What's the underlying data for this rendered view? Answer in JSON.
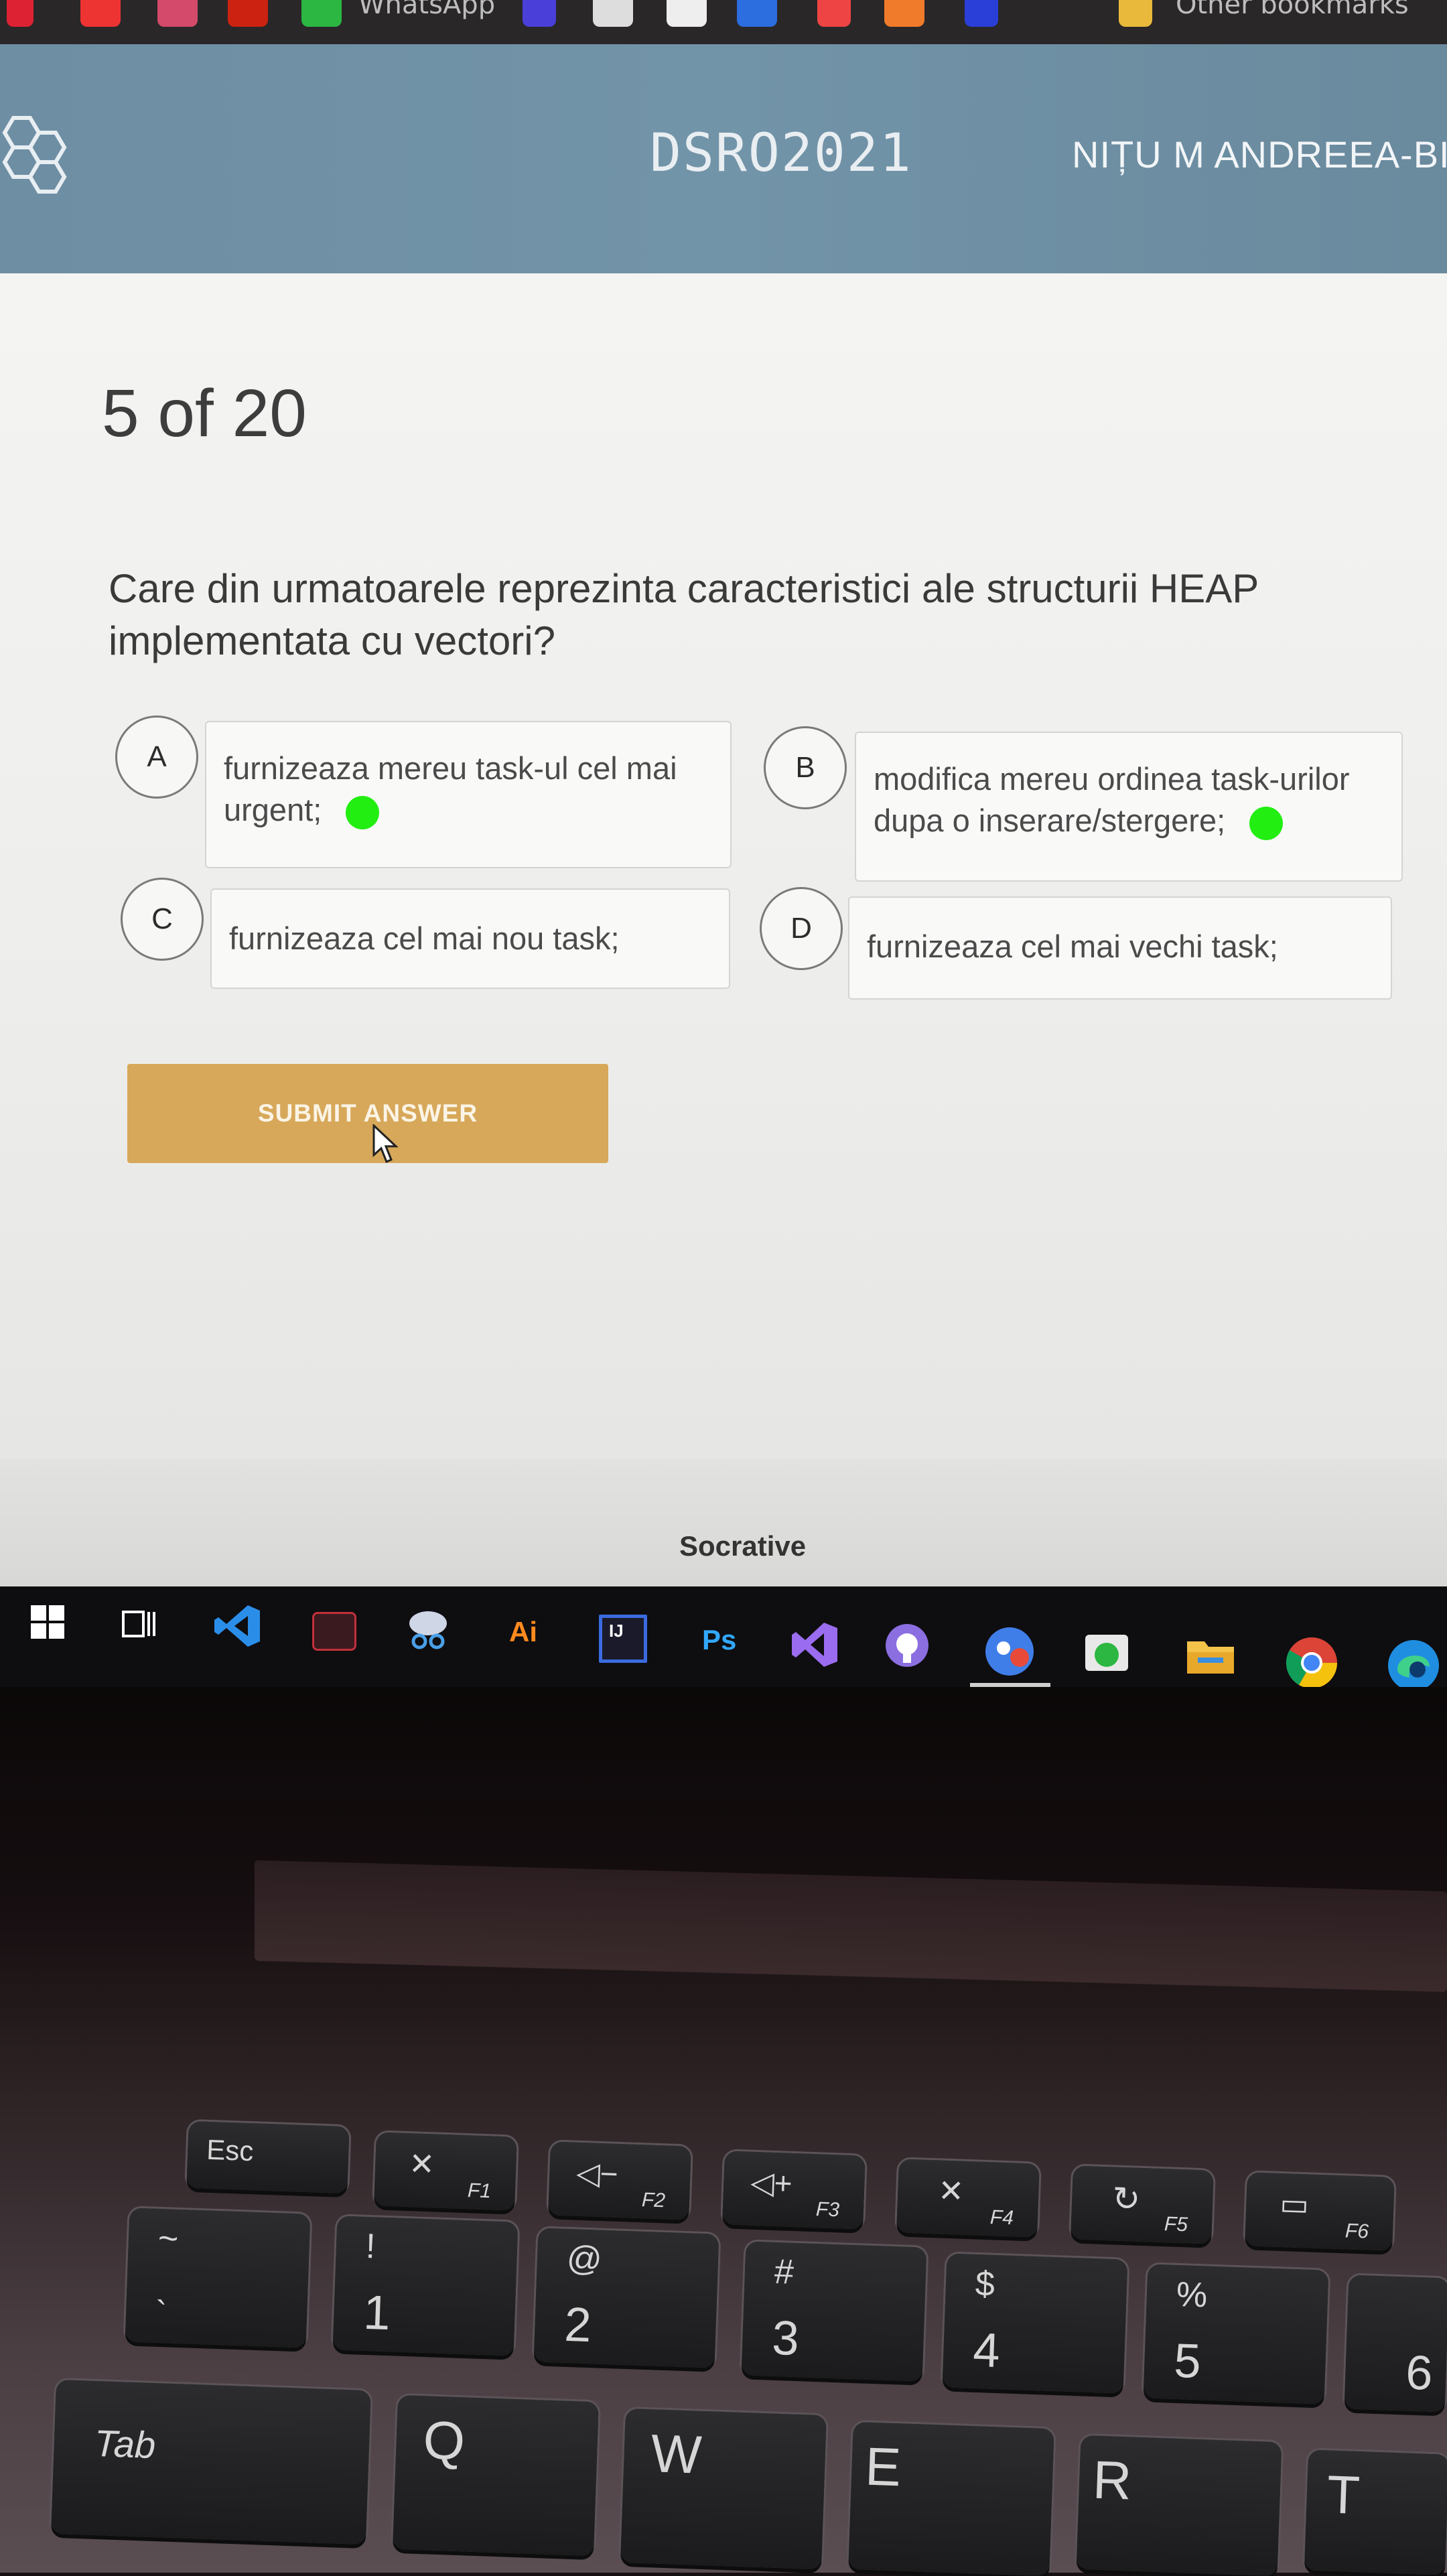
{
  "browser": {
    "bookmark_whatsapp": "WhatsApp",
    "bookmark_other": "Other bookmarks"
  },
  "header": {
    "room_name": "DSRO2021",
    "student_name": "NIȚU M ANDREEA-BI"
  },
  "quiz": {
    "progress": "5 of 20",
    "question": "Care din urmatoarele reprezinta caracteristici ale structurii HEAP implementata cu vectori?",
    "options": [
      {
        "letter": "A",
        "text": "furnizeaza mereu task-ul cel mai urgent;",
        "marked": true
      },
      {
        "letter": "B",
        "text": "modifica mereu ordinea task-urilor dupa o inserare/stergere;",
        "marked": true
      },
      {
        "letter": "C",
        "text": "furnizeaza cel mai nou task;",
        "marked": false
      },
      {
        "letter": "D",
        "text": "furnizeaza cel mai vechi task;",
        "marked": false
      }
    ],
    "marker_color": "#22ee11",
    "submit_label": "SUBMIT ANSWER"
  },
  "footer": {
    "brand": "Socrative"
  },
  "taskbar": {
    "illustrator_label": "Ai",
    "photoshop_label": "Ps",
    "intellij_label": "IJ",
    "icons": [
      "windows-start-icon",
      "task-view-icon",
      "vscode-icon",
      "mail-icon",
      "snipping-icon",
      "illustrator-icon",
      "intellij-icon",
      "photoshop-icon",
      "visual-studio-icon",
      "github-icon",
      "app-icon",
      "whatsapp-desktop-icon",
      "file-explorer-icon",
      "chrome-icon",
      "edge-icon"
    ]
  },
  "keyboard": {
    "esc": "Esc",
    "f1": "F1",
    "f2": "F2",
    "f3": "F3",
    "f4": "F4",
    "f5": "F5",
    "f6": "F6",
    "tilde_top": "~",
    "tilde_bottom": "`",
    "one_top": "!",
    "one_bottom": "1",
    "two_top": "@",
    "two_bottom": "2",
    "three_top": "#",
    "three_bottom": "3",
    "four_top": "$",
    "four_bottom": "4",
    "five_top": "%",
    "five_bottom": "5",
    "six_bottom": "6",
    "tab": "Tab",
    "q": "Q",
    "w": "W",
    "e": "E",
    "r": "R",
    "t": "T"
  }
}
